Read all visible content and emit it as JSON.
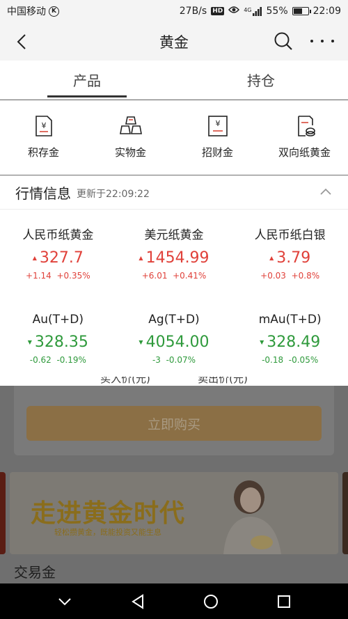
{
  "status_bar": {
    "carrier": "中国移动",
    "carrier_badge": "K",
    "speed": "27B/s",
    "hd_badge": "HD",
    "network": "4G",
    "battery": "55%",
    "battery_level": 0.55,
    "time": "22:09"
  },
  "header": {
    "title": "黄金"
  },
  "tabs": [
    {
      "label": "产品",
      "active": true
    },
    {
      "label": "持仓",
      "active": false
    }
  ],
  "products": [
    {
      "label": "积存金",
      "icon": "deposit-gold-icon"
    },
    {
      "label": "实物金",
      "icon": "gold-bars-icon"
    },
    {
      "label": "招财金",
      "icon": "fortune-gold-icon"
    },
    {
      "label": "双向纸黄金",
      "icon": "two-way-paper-gold-icon"
    }
  ],
  "market": {
    "title": "行情信息",
    "updated": "更新于22:09:22",
    "quotes": [
      {
        "name": "人民币纸黄金",
        "price": "327.7",
        "change": "+1.14",
        "percent": "+0.35%",
        "direction": "up"
      },
      {
        "name": "美元纸黄金",
        "price": "1454.99",
        "change": "+6.01",
        "percent": "+0.41%",
        "direction": "up"
      },
      {
        "name": "人民币纸白银",
        "price": "3.79",
        "change": "+0.03",
        "percent": "+0.8%",
        "direction": "up"
      },
      {
        "name": "Au(T+D)",
        "price": "328.35",
        "change": "-0.62",
        "percent": "-0.19%",
        "direction": "down"
      },
      {
        "name": "Ag(T+D)",
        "price": "4054.00",
        "change": "-3",
        "percent": "-0.07%",
        "direction": "down"
      },
      {
        "name": "mAu(T+D)",
        "price": "328.49",
        "change": "-0.18",
        "percent": "-0.05%",
        "direction": "down"
      }
    ]
  },
  "background": {
    "buy_price_label": "买入价(元)",
    "sell_price_label": "卖出价(元)",
    "buy_now": "立即购买",
    "banner_title": "走进黄金时代",
    "banner_subtitle": "轻松攒黄金，既能投资又能生息",
    "section_title": "交易金"
  },
  "colors": {
    "up": "#e0413a",
    "down": "#2f9a3c",
    "buy_button": "#8b6f45"
  }
}
